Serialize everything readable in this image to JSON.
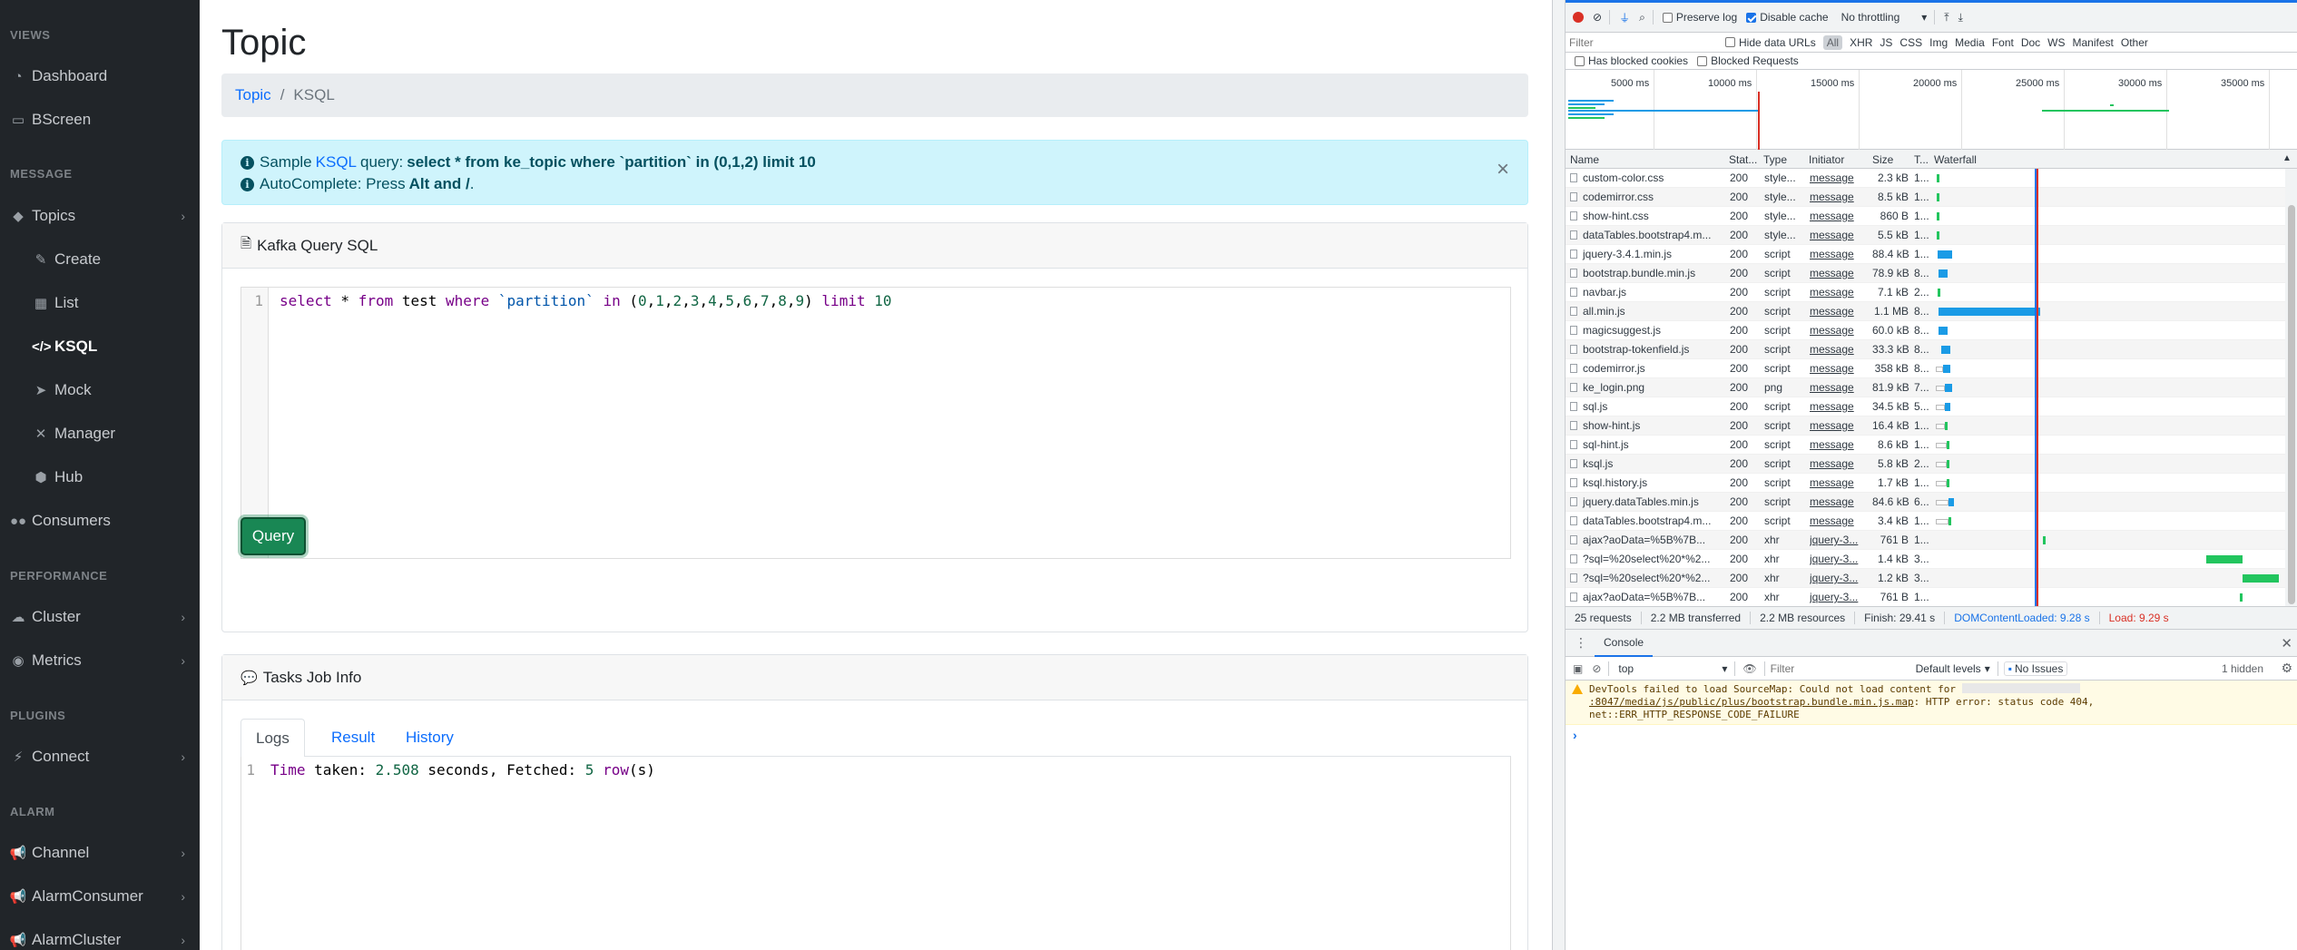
{
  "sidebar": {
    "sections": {
      "views": "VIEWS",
      "message": "MESSAGE",
      "performance": "PERFORMANCE",
      "plugins": "PLUGINS",
      "alarm": "ALARM"
    },
    "items": {
      "dashboard": "Dashboard",
      "bscreen": "BScreen",
      "topics": "Topics",
      "create": "Create",
      "list": "List",
      "ksql": "KSQL",
      "mock": "Mock",
      "manager": "Manager",
      "hub": "Hub",
      "consumers": "Consumers",
      "cluster": "Cluster",
      "metrics": "Metrics",
      "connect": "Connect",
      "channel": "Channel",
      "alarm_consumer": "AlarmConsumer",
      "alarm_cluster": "AlarmCluster"
    }
  },
  "main": {
    "title": "Topic",
    "breadcrumb": {
      "link": "Topic",
      "separator": "/",
      "current": "KSQL"
    },
    "alert": {
      "line1_prefix": "Sample",
      "line1_link": "KSQL",
      "line1_mid": "query:",
      "line1_query": "select * from ke_topic where `partition` in (0,1,2) limit 10",
      "line2_prefix": "AutoComplete: Press",
      "line2_keys": "Alt and /",
      "line2_suffix": ".",
      "close": "×"
    },
    "query_card": {
      "title": "Kafka Query SQL",
      "line_number": "1",
      "code": {
        "t1": "select",
        "t2": " * ",
        "t3": "from",
        "t4": " test ",
        "t5": "where",
        "t6": " ",
        "t7": "`partition`",
        "t8": " ",
        "t9": "in",
        "t10": " (",
        "t11": "0",
        "t12": ",",
        "t13": "1",
        "t14": ",",
        "t15": "2",
        "t16": ",",
        "t17": "3",
        "t18": ",",
        "t19": "4",
        "t20": ",",
        "t21": "5",
        "t22": ",",
        "t23": "6",
        "t24": ",",
        "t25": "7",
        "t26": ",",
        "t27": "8",
        "t28": ",",
        "t29": "9",
        "t30": ") ",
        "t31": "limit",
        "t32": " ",
        "t33": "10"
      },
      "button": "Query"
    },
    "tasks_card": {
      "title": "Tasks Job Info",
      "tabs": [
        "Logs",
        "Result",
        "History"
      ],
      "line_number": "1",
      "log": {
        "t1": "Time",
        "t2": " taken: ",
        "t3": "2.508",
        "t4": " seconds, Fetched: ",
        "t5": "5",
        "t6": " ",
        "t7": "row",
        "t8": "(s)"
      }
    }
  },
  "devtools": {
    "toolbar": {
      "preserve_log": "Preserve log",
      "disable_cache": "Disable cache",
      "throttling": "No throttling",
      "throttling_arrow": "▾"
    },
    "filter_bar": {
      "placeholder": "Filter",
      "hide_data_urls": "Hide data URLs",
      "types": [
        "All",
        "XHR",
        "JS",
        "CSS",
        "Img",
        "Media",
        "Font",
        "Doc",
        "WS",
        "Manifest",
        "Other"
      ]
    },
    "third_bar": {
      "blocked_cookies": "Has blocked cookies",
      "blocked_requests": "Blocked Requests"
    },
    "overview_ticks": [
      "5000 ms",
      "10000 ms",
      "15000 ms",
      "20000 ms",
      "25000 ms",
      "30000 ms",
      "35000 ms"
    ],
    "columns": {
      "name": "Name",
      "status": "Stat...",
      "type": "Type",
      "initiator": "Initiator",
      "size": "Size",
      "time": "T...",
      "waterfall": "Waterfall"
    },
    "requests": [
      {
        "name": "custom-color.css",
        "status": "200",
        "type": "style...",
        "initiator": "message",
        "size": "2.3 kB",
        "time": "1..."
      },
      {
        "name": "codemirror.css",
        "status": "200",
        "type": "style...",
        "initiator": "message",
        "size": "8.5 kB",
        "time": "1..."
      },
      {
        "name": "show-hint.css",
        "status": "200",
        "type": "style...",
        "initiator": "message",
        "size": "860 B",
        "time": "1..."
      },
      {
        "name": "dataTables.bootstrap4.m...",
        "status": "200",
        "type": "style...",
        "initiator": "message",
        "size": "5.5 kB",
        "time": "1..."
      },
      {
        "name": "jquery-3.4.1.min.js",
        "status": "200",
        "type": "script",
        "initiator": "message",
        "size": "88.4 kB",
        "time": "1..."
      },
      {
        "name": "bootstrap.bundle.min.js",
        "status": "200",
        "type": "script",
        "initiator": "message",
        "size": "78.9 kB",
        "time": "8..."
      },
      {
        "name": "navbar.js",
        "status": "200",
        "type": "script",
        "initiator": "message",
        "size": "7.1 kB",
        "time": "2..."
      },
      {
        "name": "all.min.js",
        "status": "200",
        "type": "script",
        "initiator": "message",
        "size": "1.1 MB",
        "time": "8..."
      },
      {
        "name": "magicsuggest.js",
        "status": "200",
        "type": "script",
        "initiator": "message",
        "size": "60.0 kB",
        "time": "8..."
      },
      {
        "name": "bootstrap-tokenfield.js",
        "status": "200",
        "type": "script",
        "initiator": "message",
        "size": "33.3 kB",
        "time": "8..."
      },
      {
        "name": "codemirror.js",
        "status": "200",
        "type": "script",
        "initiator": "message",
        "size": "358 kB",
        "time": "8..."
      },
      {
        "name": "ke_login.png",
        "status": "200",
        "type": "png",
        "initiator": "message",
        "size": "81.9 kB",
        "time": "7..."
      },
      {
        "name": "sql.js",
        "status": "200",
        "type": "script",
        "initiator": "message",
        "size": "34.5 kB",
        "time": "5..."
      },
      {
        "name": "show-hint.js",
        "status": "200",
        "type": "script",
        "initiator": "message",
        "size": "16.4 kB",
        "time": "1..."
      },
      {
        "name": "sql-hint.js",
        "status": "200",
        "type": "script",
        "initiator": "message",
        "size": "8.6 kB",
        "time": "1..."
      },
      {
        "name": "ksql.js",
        "status": "200",
        "type": "script",
        "initiator": "message",
        "size": "5.8 kB",
        "time": "2..."
      },
      {
        "name": "ksql.history.js",
        "status": "200",
        "type": "script",
        "initiator": "message",
        "size": "1.7 kB",
        "time": "1..."
      },
      {
        "name": "jquery.dataTables.min.js",
        "status": "200",
        "type": "script",
        "initiator": "message",
        "size": "84.6 kB",
        "time": "6..."
      },
      {
        "name": "dataTables.bootstrap4.m...",
        "status": "200",
        "type": "script",
        "initiator": "message",
        "size": "3.4 kB",
        "time": "1..."
      },
      {
        "name": "ajax?aoData=%5B%7B...",
        "status": "200",
        "type": "xhr",
        "initiator": "jquery-3...",
        "size": "761 B",
        "time": "1..."
      },
      {
        "name": "?sql=%20select%20*%2...",
        "status": "200",
        "type": "xhr",
        "initiator": "jquery-3...",
        "size": "1.4 kB",
        "time": "3..."
      },
      {
        "name": "?sql=%20select%20*%2...",
        "status": "200",
        "type": "xhr",
        "initiator": "jquery-3...",
        "size": "1.2 kB",
        "time": "3..."
      },
      {
        "name": "ajax?aoData=%5B%7B...",
        "status": "200",
        "type": "xhr",
        "initiator": "jquery-3...",
        "size": "761 B",
        "time": "1..."
      }
    ],
    "status_bar": {
      "requests": "25 requests",
      "transferred": "2.2 MB transferred",
      "resources": "2.2 MB resources",
      "finish": "Finish: 29.41 s",
      "dom_loaded": "DOMContentLoaded: 9.28 s",
      "load": "Load: 9.29 s"
    },
    "console": {
      "tab": "Console",
      "context": "top",
      "filter_placeholder": "Filter",
      "levels": "Default levels",
      "issues": "No Issues",
      "hidden": "1 hidden",
      "warning_prefix": "DevTools failed to load SourceMap: Could not load content for ",
      "warning_url": ":8047/media/js/public/plus/bootstrap.bundle.min.js.map",
      "warning_suffix": ": HTTP error: status code 404, net::ERR_HTTP_RESPONSE_CODE_FAILURE",
      "prompt": "›"
    },
    "colors": {
      "blue_bar": "#1a9be6",
      "green_bar": "#22c55e",
      "red_line": "#d93025",
      "dom_blue": "#1a73e8"
    }
  }
}
